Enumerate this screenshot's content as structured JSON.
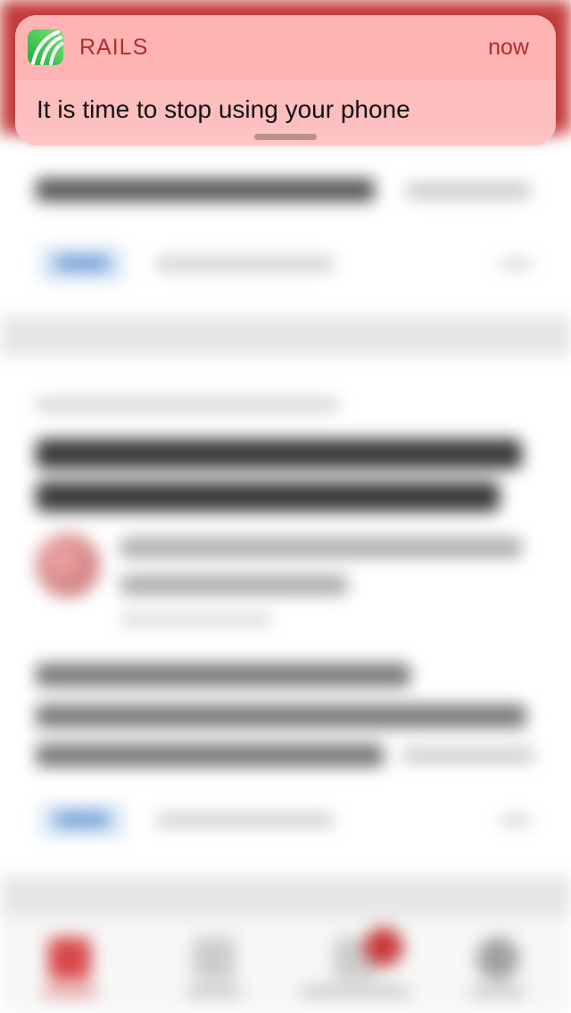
{
  "notification": {
    "app_name": "RAILS",
    "time": "now",
    "message": "It is time to stop using your phone",
    "app_icon": "rails-app-icon"
  },
  "colors": {
    "notification_bg": "#ffc4c4",
    "notification_header_bg": "#ffb2b2",
    "app_name_color": "#b52b2b",
    "status_bar_bg": "#c33a3a"
  }
}
